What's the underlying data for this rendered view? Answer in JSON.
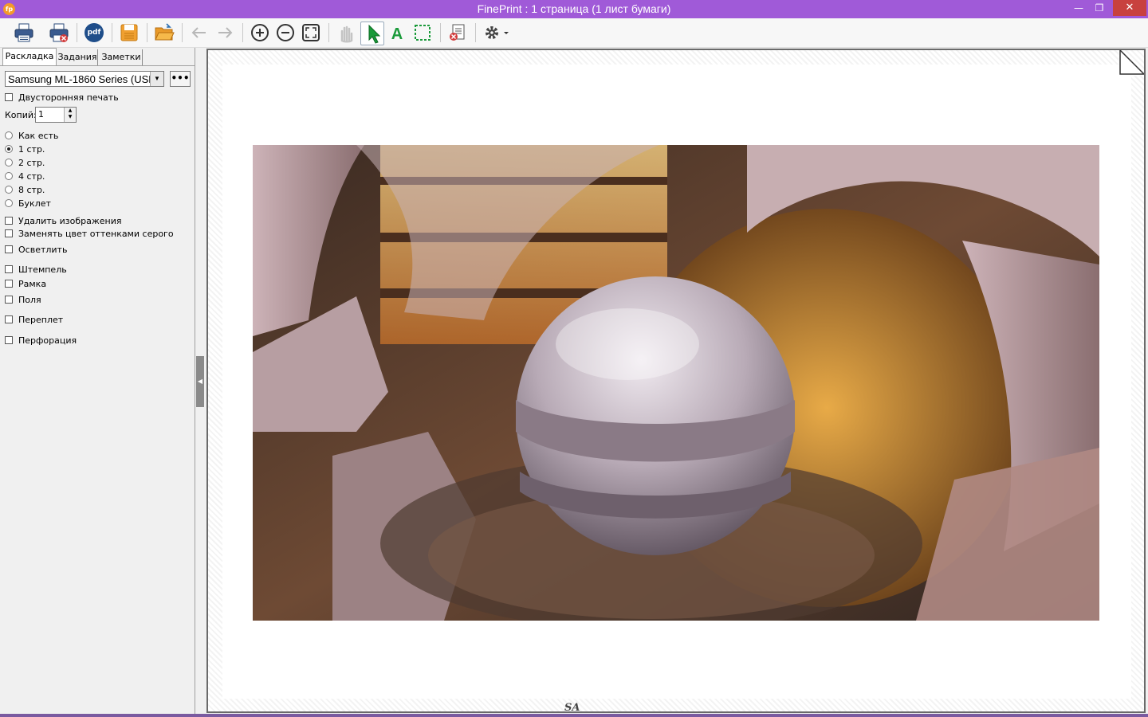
{
  "window": {
    "title": "FinePrint : 1 страница (1 лист бумаги)",
    "app_icon_text": "fp",
    "minimize": "—",
    "maximize": "❐",
    "close": "✕",
    "title_bar_color": "#a05ad8"
  },
  "toolbar": {
    "buttons": [
      {
        "icon": "print-icon"
      },
      {
        "icon": "print-delete-icon"
      },
      {
        "icon": "pdf-icon",
        "label": "pdf"
      },
      {
        "icon": "save-icon"
      },
      {
        "icon": "open-folder-icon"
      },
      {
        "icon": "arrow-left-icon"
      },
      {
        "icon": "arrow-right-icon"
      },
      {
        "icon": "zoom-in-icon"
      },
      {
        "icon": "zoom-out-icon"
      },
      {
        "icon": "fit-page-icon"
      },
      {
        "icon": "hand-icon"
      },
      {
        "icon": "pointer-icon"
      },
      {
        "icon": "text-icon",
        "label": "A"
      },
      {
        "icon": "select-region-icon"
      },
      {
        "icon": "delete-page-icon"
      },
      {
        "icon": "settings-icon"
      }
    ]
  },
  "left_panel": {
    "tabs": [
      {
        "label": "Раскладка",
        "active": true
      },
      {
        "label": "Задания",
        "active": false
      },
      {
        "label": "Заметки",
        "active": false
      }
    ],
    "printer": {
      "value": "Samsung ML-1860 Series (USB",
      "more_label": "•••"
    },
    "duplex": {
      "label": "Двусторонняя печать",
      "checked": false
    },
    "copies": {
      "label": "Копий:",
      "value": "1"
    },
    "layout_options": [
      {
        "label": "Как есть",
        "selected": false
      },
      {
        "label": "1 стр.",
        "selected": true
      },
      {
        "label": "2 стр.",
        "selected": false
      },
      {
        "label": "4 стр.",
        "selected": false
      },
      {
        "label": "8 стр.",
        "selected": false
      },
      {
        "label": "Буклет",
        "selected": false
      }
    ],
    "checkboxes": [
      {
        "label": "Удалить изображения",
        "checked": false
      },
      {
        "label": "Заменять цвет оттенками серого",
        "checked": false
      },
      {
        "label": "Осветлить",
        "checked": false
      },
      {
        "label": "Штемпель",
        "checked": false
      },
      {
        "label": "Рамка",
        "checked": false
      },
      {
        "label": "Поля",
        "checked": false
      },
      {
        "label": "Переплет",
        "checked": false
      },
      {
        "label": "Перфорация",
        "checked": false
      }
    ]
  },
  "preview": {
    "watermark": "SA"
  }
}
